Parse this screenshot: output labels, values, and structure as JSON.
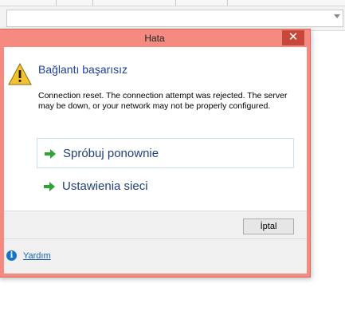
{
  "dialog": {
    "title": "Hata",
    "close_glyph": "✕",
    "heading": "Bağlantı başarısız",
    "message": "Connection reset. The connection attempt was rejected. The server may be down, or your network may not be properly configured.",
    "actions": [
      {
        "label": "Spróbuj ponownie",
        "icon": "green-arrow-icon",
        "focused": true
      },
      {
        "label": "Ustawienia sieci",
        "icon": "green-arrow-icon",
        "focused": false
      }
    ],
    "cancel_label": "İptal",
    "help_label": "Yardım",
    "info_glyph": "i"
  },
  "colors": {
    "frame": "#f58b80",
    "close_button": "#c7473a",
    "heading": "#1e3f9c",
    "action_text": "#1f3f7a",
    "link": "#1a5fb4",
    "arrow": "#2fa335",
    "warning": "#f2c230"
  }
}
